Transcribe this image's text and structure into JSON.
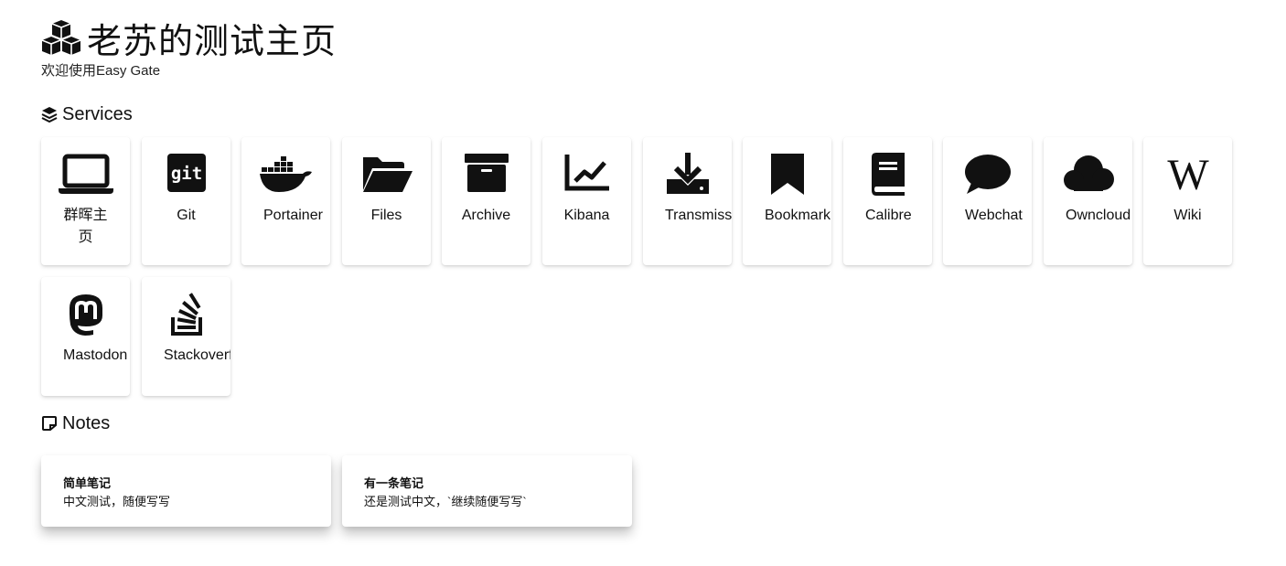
{
  "header": {
    "title": "老苏的测试主页",
    "subtitle": "欢迎使用Easy Gate",
    "icon": "cubes-icon"
  },
  "services_section": {
    "label": "Services",
    "icon": "layers-icon",
    "items": [
      {
        "name": "群晖主页",
        "icon": "laptop-icon"
      },
      {
        "name": "Git",
        "icon": "git-icon"
      },
      {
        "name": "Portainer",
        "icon": "docker-icon"
      },
      {
        "name": "Files",
        "icon": "folder-open-icon"
      },
      {
        "name": "Archive",
        "icon": "archive-icon"
      },
      {
        "name": "Kibana",
        "icon": "chart-line-icon"
      },
      {
        "name": "Transmission",
        "icon": "download-icon"
      },
      {
        "name": "Bookmark",
        "icon": "bookmark-icon"
      },
      {
        "name": "Calibre",
        "icon": "book-icon"
      },
      {
        "name": "Webchat",
        "icon": "comment-icon"
      },
      {
        "name": "Owncloud",
        "icon": "cloud-icon"
      },
      {
        "name": "Wiki",
        "icon": "wikipedia-icon"
      },
      {
        "name": "Mastodon",
        "icon": "mastodon-icon"
      },
      {
        "name": "Stackoverflow",
        "icon": "stack-overflow-icon"
      }
    ]
  },
  "notes_section": {
    "label": "Notes",
    "icon": "sticky-note-icon",
    "items": [
      {
        "title": "简单笔记",
        "content": "中文测试，随便写写"
      },
      {
        "title": "有一条笔记",
        "content": "还是测试中文，`继续随便写写`"
      }
    ]
  }
}
